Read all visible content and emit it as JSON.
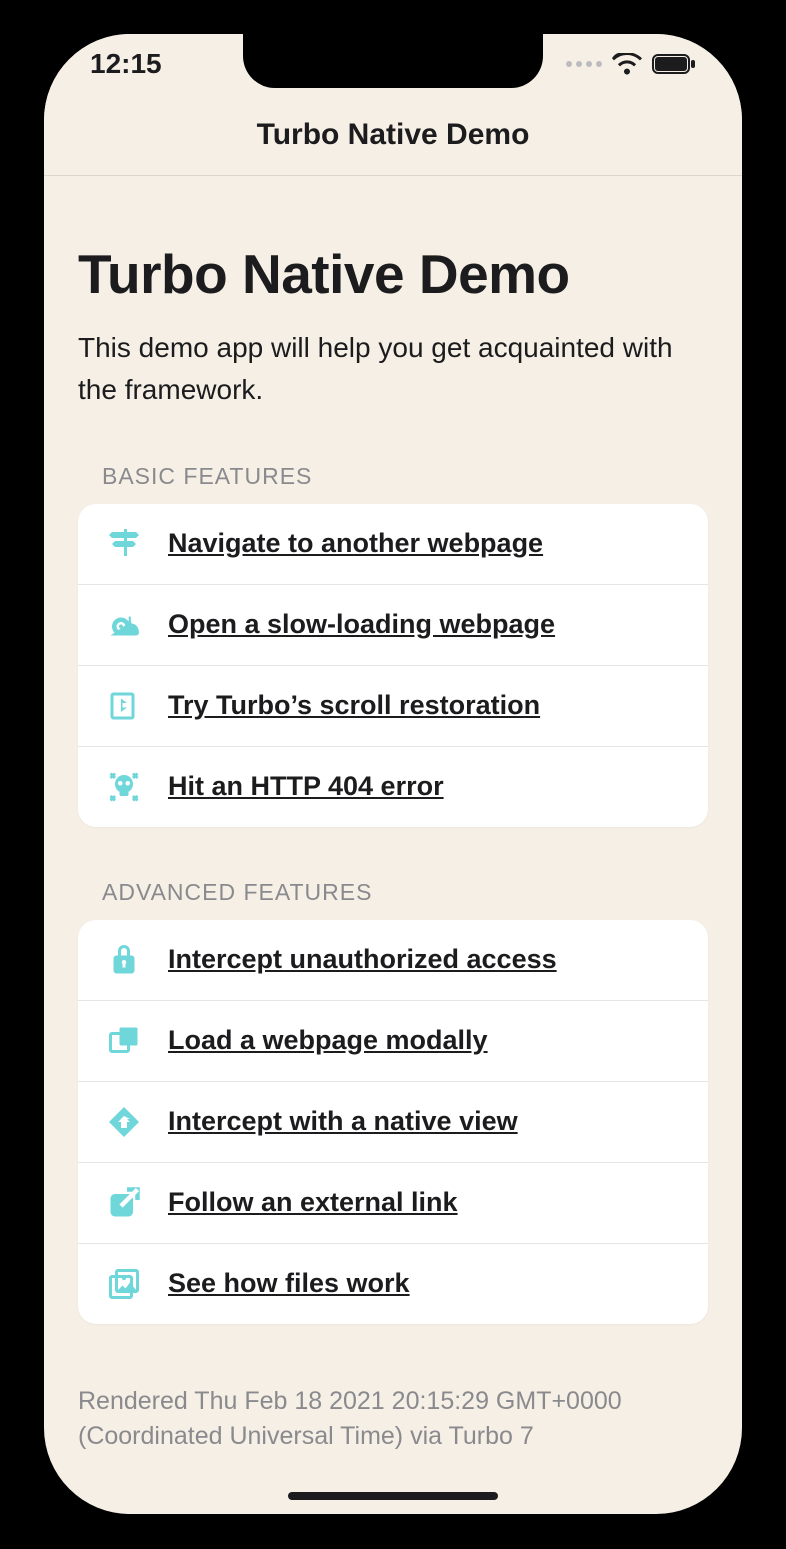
{
  "status": {
    "time": "12:15"
  },
  "nav": {
    "title": "Turbo Native Demo"
  },
  "page": {
    "title": "Turbo Native Demo",
    "subtitle": "This demo app will help you get acquainted with the framework."
  },
  "sections": {
    "basic": {
      "heading": "BASIC FEATURES",
      "items": [
        {
          "label": "Navigate to another webpage"
        },
        {
          "label": "Open a slow-loading webpage"
        },
        {
          "label": "Try Turbo’s scroll restoration"
        },
        {
          "label": "Hit an HTTP 404 error"
        }
      ]
    },
    "advanced": {
      "heading": "ADVANCED FEATURES",
      "items": [
        {
          "label": "Intercept unauthorized access"
        },
        {
          "label": "Load a webpage modally"
        },
        {
          "label": "Intercept with a native view"
        },
        {
          "label": "Follow an external link"
        },
        {
          "label": "See how files work"
        }
      ]
    }
  },
  "footer": "Rendered Thu Feb 18 2021 20:15:29 GMT+0000 (Coordinated Universal Time) via Turbo 7"
}
